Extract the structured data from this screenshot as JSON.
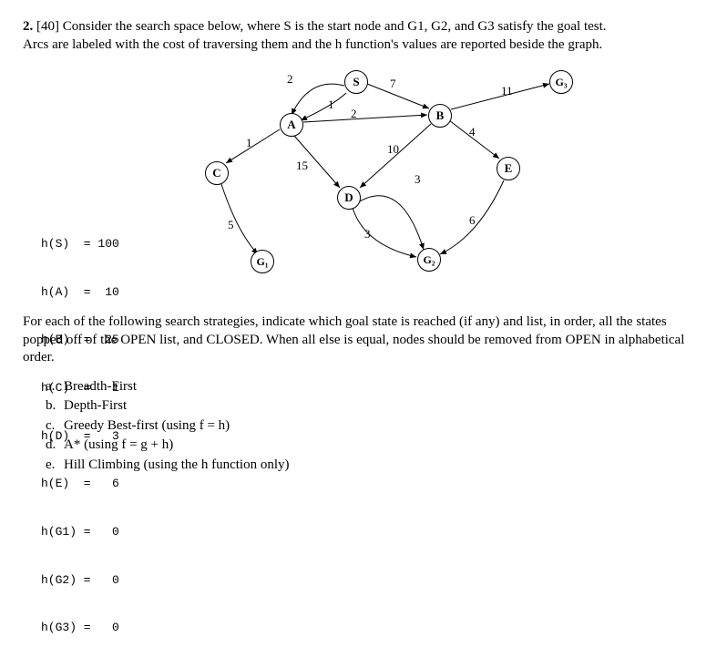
{
  "question": {
    "number": "2.",
    "points": "[40]",
    "prompt1": "Consider the search space below, where S is the start node and G1, G2, and G3 satisfy the goal test.",
    "prompt2": "Arcs are labeled with the cost of traversing them and the h function's values are reported beside the graph."
  },
  "nodes": {
    "S": "S",
    "A": "A",
    "B": "B",
    "C": "C",
    "D": "D",
    "E": "E",
    "G1": "G₁",
    "G2": "G₂",
    "G3": "G₃"
  },
  "edge_costs": {
    "SA_via2": "2",
    "SA_via1": "1",
    "SB": "7",
    "AB": "2",
    "AC": "1",
    "AD": "15",
    "BD": "10",
    "BE": "4",
    "BG3": "11",
    "CG1": "5",
    "DG2_via3a": "3",
    "DG2_via3b": "3",
    "EG2": "6"
  },
  "hvalues": [
    "h(S)  = 100",
    "h(A)  =  10",
    "h(B)  =  25",
    "h(C)  =   1",
    "h(D)  =   3",
    "h(E)  =   6",
    "h(G1) =   0",
    "h(G2) =   0",
    "h(G3) =   0"
  ],
  "instructions": "For each of the following search strategies, indicate which goal state is reached (if any) and list, in order, all the states popped off of the OPEN list, and CLOSED. When all else is equal, nodes should be removed from OPEN in alphabetical order.",
  "subquestions": [
    {
      "letter": "a.",
      "text": "Breadth-First"
    },
    {
      "letter": "b.",
      "text": "Depth-First"
    },
    {
      "letter": "c.",
      "text": "Greedy Best-first (using f = h)"
    },
    {
      "letter": "d.",
      "text": "A* (using f = g + h)"
    },
    {
      "letter": "e.",
      "text": "Hill Climbing (using the h function only)"
    }
  ]
}
